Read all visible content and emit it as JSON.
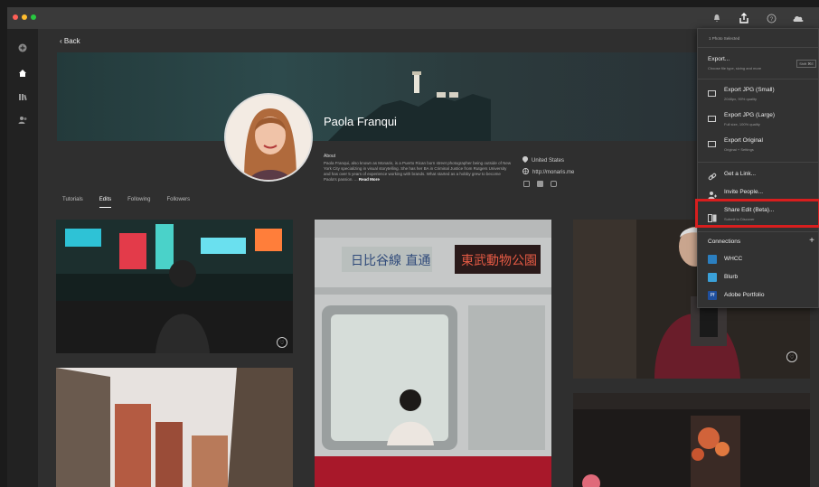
{
  "nav": {
    "back_label": "Back"
  },
  "profile": {
    "name": "Paola Franqui",
    "about_heading": "About",
    "about_text": "Paola Franqui, also known as Monaris, is a Puerto Rican born street photographer being outside of New York City specializing in visual storytelling. She has her BA in Criminal Justice from Rutgers University and has over 5 years of experience working with brands. What started as a hobby grew to become Paola's passion. ...",
    "read_more": "Read More",
    "location": "United States",
    "url": "http://monaris.me"
  },
  "tabs": [
    "Tutorials",
    "Edits",
    "Following",
    "Followers"
  ],
  "menu": {
    "header": "1 Photo Selected",
    "export": {
      "label": "Export...",
      "sub": "Choose file type, sizing and more",
      "shortcut": "Shift ⌘E"
    },
    "presets": [
      {
        "label": "Export JPG (Small)",
        "sub": "2048px, 90% quality"
      },
      {
        "label": "Export JPG (Large)",
        "sub": "Full size, 100% quality"
      },
      {
        "label": "Export Original",
        "sub": "Original + Settings"
      }
    ],
    "get_link": "Get a Link...",
    "invite": "Invite People...",
    "share_edit": {
      "label": "Share Edit (Beta)...",
      "sub": "Submit to Discover"
    },
    "connections_label": "Connections",
    "connections_add": "+",
    "connections": [
      {
        "label": "WHCC",
        "color": "#2b7fc0"
      },
      {
        "label": "Blurb",
        "color": "#3aa0d8"
      },
      {
        "label": "Adobe Portfolio",
        "color": "#1f4f9e",
        "mark": "Pf"
      }
    ]
  },
  "accent": "#d81e1e"
}
